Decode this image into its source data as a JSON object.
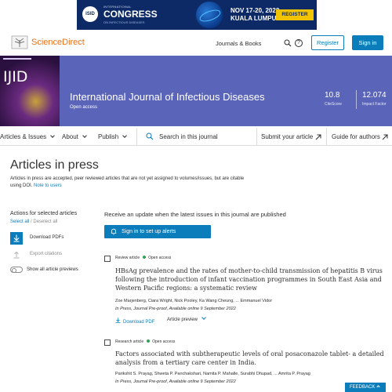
{
  "ad": {
    "logo_text": "ISID",
    "intl_text": "INTERNATIONAL",
    "congress": "CONGRESS",
    "sub_text": "ON INFECTIOUS DISEASES",
    "date_line1": "NOV 17-20, 2022",
    "date_line2": "KUALA LUMPUR",
    "register": "REGISTER NOW"
  },
  "header": {
    "brand": "ScienceDirect",
    "journals_books": "Journals & Books",
    "help_glyph": "?",
    "register": "Register",
    "sign_in": "Sign in"
  },
  "journal": {
    "cover_text": "IJID",
    "title": "International Journal of Infectious Diseases",
    "access": "Open access",
    "metrics": [
      {
        "value": "10.8",
        "label": "CiteScore"
      },
      {
        "value": "12.074",
        "label": "Impact Factor"
      }
    ]
  },
  "nav": {
    "articles_issues": "Articles & Issues",
    "about": "About",
    "publish": "Publish",
    "search_placeholder": "Search in this journal",
    "submit": "Submit your article",
    "guide": "Guide for authors"
  },
  "page": {
    "title": "Articles in press",
    "desc": "Articles in press are accepted, peer reviewed articles that are not yet assigned to volumes/issues, but are citable using DOI.",
    "note_link": "Note to users"
  },
  "actions": {
    "title": "Actions for selected articles",
    "select_all": "Select all",
    "divider": " / ",
    "deselect_all": "Deselect all",
    "download": "Download PDFs",
    "export": "Export citations",
    "show_previews": "Show all article previews"
  },
  "updates": {
    "text": "Receive an update when the latest issues in this journal are published",
    "button": "Sign in to set up alerts"
  },
  "articles": [
    {
      "type": "Review article",
      "access": "Open access",
      "title": "HBsAg prevalence and the rates of mother-to-child transmission of hepatitis B virus following the introduction of infant vaccination programmes in South East Asia and Western Pacific regions: a systematic review",
      "authors": "Zoe Marjenberg, Ciara Wright, Nick Pooley, Ka Wang Cheung, ... Emmanuel Vidor",
      "info": "In Press, Journal Pre-proof, Available online 9 September 2022",
      "pdf": "Download PDF",
      "preview": "Article preview"
    },
    {
      "type": "Research article",
      "access": "Open access",
      "title": "Factors associated with subtherapeutic levels of oral posaconazole tablet- a detailed analysis from a tertiary care center in India.",
      "authors": "Parikshit S. Prayag, Shweta P. Panchakshari, Namita P. Mahalle, Surabhi Dhupad, ... Amrita P. Prayag",
      "info": "In Press, Journal Pre-proof, Available online 9 September 2022"
    }
  ],
  "feedback": "FEEDBACK"
}
